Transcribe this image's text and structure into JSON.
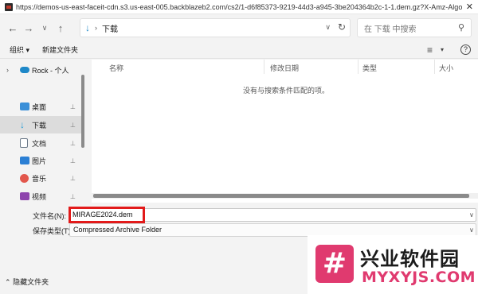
{
  "window": {
    "url_title": "https://demos-us-east-faceit-cdn.s3.us-east-005.backblazeb2.com/cs2/1-d6f85373-9219-44d3-a945-3be204364b2c-1-1.dem.gz?X-Amz-Algorith",
    "close_glyph": "✕"
  },
  "nav": {
    "back_glyph": "←",
    "forward_glyph": "→",
    "recent_glyph": "∨",
    "up_glyph": "↑",
    "location": "下载",
    "path_separator": "›",
    "refresh_glyph": "↻",
    "chevron_glyph": "∨",
    "search_placeholder": "在 下载 中搜索"
  },
  "toolbar": {
    "organize": "组织 ▾",
    "new_folder": "新建文件夹",
    "view_glyph": "≡",
    "view_dropdown": "▾",
    "help_glyph": "?"
  },
  "sidebar": {
    "items": [
      {
        "label": "Rock - 个人",
        "icon": "cloud-icon",
        "color": "#1e88c8",
        "pinned": false,
        "expandable": true
      },
      {
        "label": "桌面",
        "icon": "desktop-icon",
        "color": "#3a8fd8",
        "pinned": true
      },
      {
        "label": "下载",
        "icon": "download-icon",
        "color": "#1e9bd6",
        "pinned": true,
        "selected": true
      },
      {
        "label": "文档",
        "icon": "document-icon",
        "color": "#6c7a89",
        "pinned": true
      },
      {
        "label": "图片",
        "icon": "pictures-icon",
        "color": "#2b7fd4",
        "pinned": true
      },
      {
        "label": "音乐",
        "icon": "music-icon",
        "color": "#e2574c",
        "pinned": true
      },
      {
        "label": "视频",
        "icon": "video-icon",
        "color": "#8e44ad",
        "pinned": true
      }
    ],
    "pin_glyph": "📌",
    "expander_glyph": "›"
  },
  "file_list": {
    "columns": [
      "名称",
      "修改日期",
      "类型",
      "大小"
    ],
    "empty_message": "没有与搜索条件匹配的项。"
  },
  "save_form": {
    "filename_label": "文件名(N):",
    "filename_value": "MIRAGE2024.dem",
    "filetype_label": "保存类型(T):",
    "filetype_value": "Compressed Archive Folder",
    "dropdown_glyph": "∨"
  },
  "footer": {
    "hide_folders": "隐藏文件夹"
  },
  "watermark": {
    "logo_glyph": "#",
    "title": "兴业软件园",
    "subtitle": "MYXYJS.COM"
  },
  "colors": {
    "highlight_box": "#e21a1a",
    "watermark_accent": "#e03a6f"
  }
}
